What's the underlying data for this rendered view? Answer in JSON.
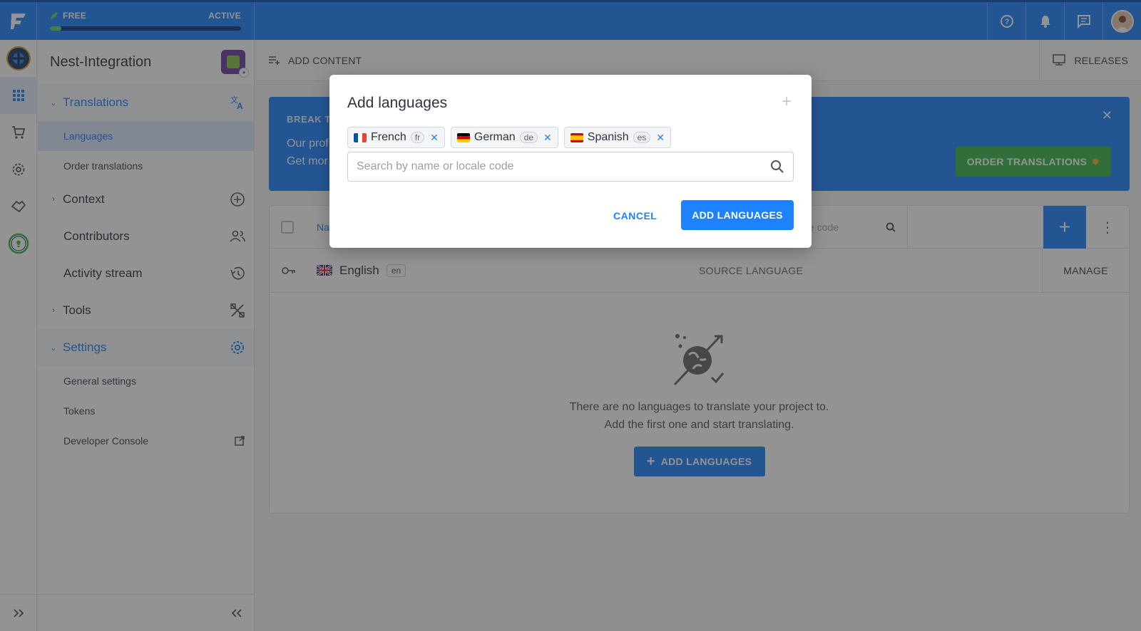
{
  "plan": {
    "name": "FREE",
    "status": "ACTIVE",
    "progress_pct": 6
  },
  "colors": {
    "accent": "#1e82ff",
    "success": "#3bb54a",
    "topbar": "#1e82ff"
  },
  "topbar_icons": [
    "help-icon",
    "bell-icon",
    "chat-icon",
    "user-avatar"
  ],
  "rail": [
    "project-logo",
    "dashboard-icon",
    "cart-icon",
    "gear-icon",
    "handshake-icon",
    "lightbulb-icon"
  ],
  "sidebar": {
    "project_name": "Nest-Integration",
    "translations": "Translations",
    "languages": "Languages",
    "order_translations": "Order translations",
    "context": "Context",
    "contributors": "Contributors",
    "activity_stream": "Activity stream",
    "tools": "Tools",
    "settings": "Settings",
    "general_settings": "General settings",
    "tokens": "Tokens",
    "developer_console": "Developer Console"
  },
  "toolbar": {
    "add_content": "ADD CONTENT",
    "releases": "RELEASES"
  },
  "banner": {
    "title": "BREAK T",
    "line1": "Our prof",
    "line2": "Get mor",
    "button": "ORDER TRANSLATIONS"
  },
  "table": {
    "col_name": "Na",
    "search_placeholder": "e code",
    "rows": [
      {
        "name": "English",
        "code": "en",
        "role": "SOURCE LANGUAGE",
        "action": "MANAGE"
      }
    ]
  },
  "empty": {
    "line1": "There are no languages to translate your project to.",
    "line2": "Add the first one and start translating.",
    "button": "ADD LANGUAGES"
  },
  "modal": {
    "title": "Add languages",
    "chips": [
      {
        "name": "French",
        "code": "fr"
      },
      {
        "name": "German",
        "code": "de"
      },
      {
        "name": "Spanish",
        "code": "es"
      }
    ],
    "search_placeholder": "Search by name or locale code",
    "cancel": "CANCEL",
    "confirm": "ADD LANGUAGES"
  }
}
